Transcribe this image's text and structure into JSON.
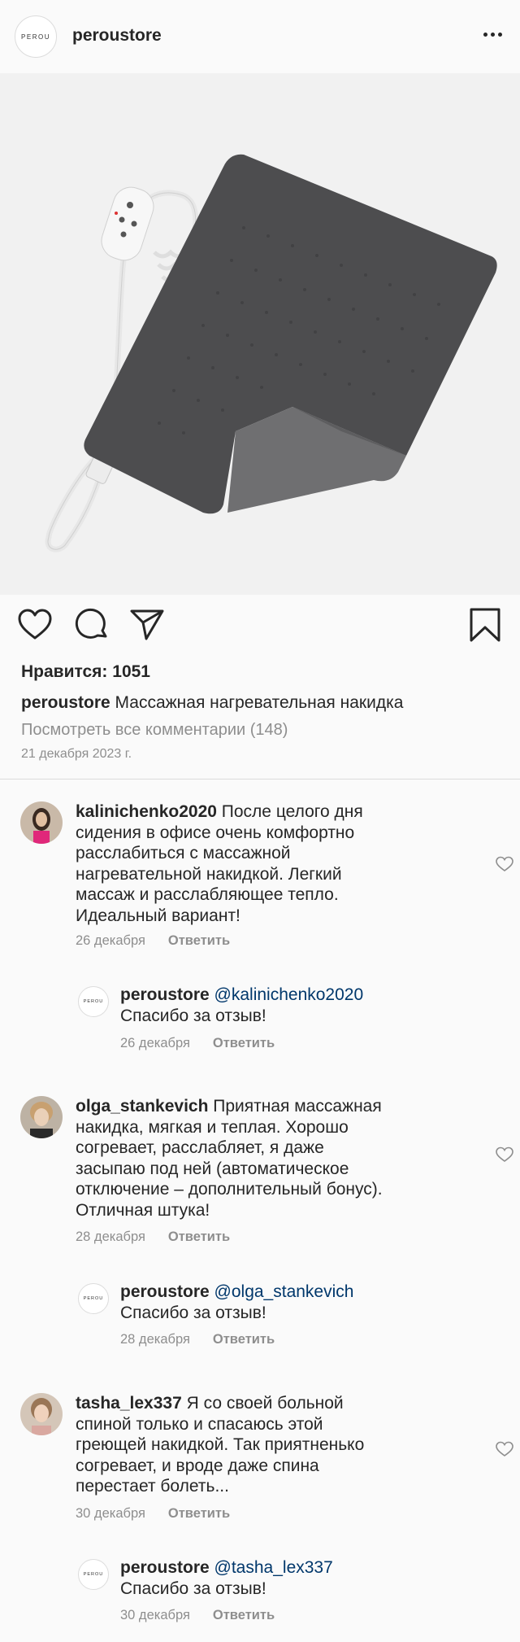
{
  "header": {
    "logo_text": "PEROU",
    "username": "peroustore",
    "more_icon": "more-dots-icon"
  },
  "post": {
    "likes_label": "Нравится: 1051",
    "caption_user": "peroustore",
    "caption_text": "Массажная нагревательная накидка",
    "view_all": "Посмотреть все комментарии (148)",
    "date": "21 декабря 2023 г.",
    "icons": {
      "like": "heart-icon",
      "comment": "comment-icon",
      "share": "paper-plane-icon",
      "save": "bookmark-icon"
    }
  },
  "comments": [
    {
      "user": "kalinichenko2020",
      "lines": [
        "После целого дня",
        "сидения в офисе очень комфортно",
        "расслабиться с массажной",
        "нагревательной накидкой. Легкий",
        "массаж и расслабляющее тепло.",
        "Идеальный вариант!"
      ],
      "date": "26 декабря",
      "reply_label": "Ответить",
      "reply": {
        "logo_text": "PEROU",
        "user": "peroustore",
        "mention": "@kalinichenko2020",
        "text": "Спасибо за отзыв!",
        "date": "26 декабря",
        "reply_label": "Ответить"
      }
    },
    {
      "user": "olga_stankevich",
      "lines": [
        "Приятная массажная",
        "накидка, мягкая и теплая. Хорошо",
        "согревает, расслабляет, я даже",
        "засыпаю под ней (автоматическое",
        "отключение – дополнительный бонус).",
        "Отличная штука!"
      ],
      "date": "28 декабря",
      "reply_label": "Ответить",
      "reply": {
        "logo_text": "PEROU",
        "user": "peroustore",
        "mention": "@olga_stankevich",
        "text": "Спасибо за отзыв!",
        "date": "28 декабря",
        "reply_label": "Ответить"
      }
    },
    {
      "user": "tasha_lex337",
      "lines": [
        "Я со своей больной",
        "спиной только и спасаюсь этой",
        "греющей накидкой. Так приятненько",
        "согревает, и вроде даже спина",
        "перестает болеть..."
      ],
      "date": "30 декабря",
      "reply_label": "Ответить",
      "reply": {
        "logo_text": "PEROU",
        "user": "peroustore",
        "mention": "@tasha_lex337",
        "text": "Спасибо за отзыв!",
        "date": "30 декабря",
        "reply_label": "Ответить"
      }
    }
  ]
}
